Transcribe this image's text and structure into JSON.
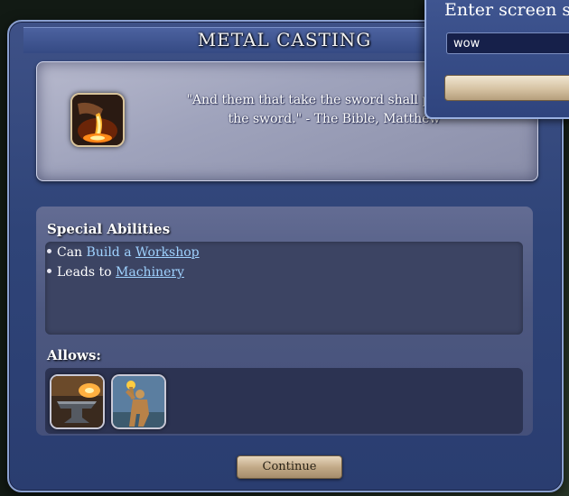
{
  "panel": {
    "title": "METAL CASTING",
    "tech_icon": "metal-casting-icon",
    "quote": "\"And them that take the sword shall perish by the sword.\" - The Bible, Matthew"
  },
  "special_abilities": {
    "heading": "Special Abilities",
    "items": [
      {
        "prefix": "Can ",
        "plain_link": "Build a ",
        "link": "Workshop"
      },
      {
        "prefix": "Leads to ",
        "plain_link": "",
        "link": "Machinery"
      }
    ]
  },
  "allows": {
    "heading": "Allows:",
    "items": [
      {
        "icon": "forge-anvil-icon"
      },
      {
        "icon": "colossus-statue-icon"
      }
    ]
  },
  "continue_label": "Continue",
  "dialog": {
    "title": "Enter screen sh",
    "input_value": "wow"
  }
}
